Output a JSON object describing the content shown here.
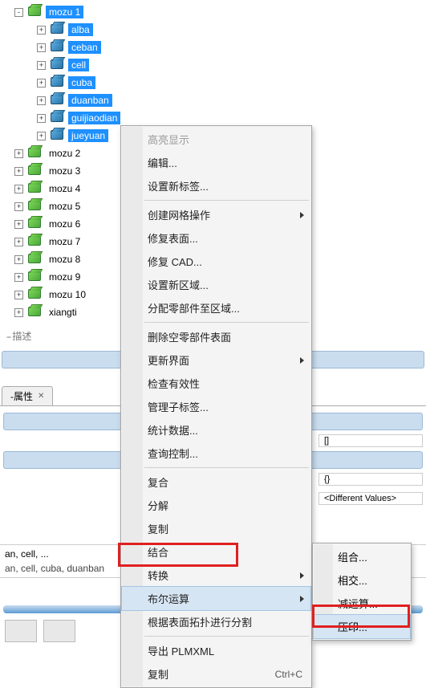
{
  "tree": {
    "root": {
      "label": "mozu 1",
      "expander": "-"
    },
    "selected_children": [
      {
        "label": "alba",
        "expander": "+"
      },
      {
        "label": "ceban",
        "expander": "+"
      },
      {
        "label": "cell",
        "expander": "+"
      },
      {
        "label": "cuba",
        "expander": "+"
      },
      {
        "label": "duanban",
        "expander": "+"
      },
      {
        "label": "guijiaodian",
        "expander": "+"
      },
      {
        "label": "jueyuan",
        "expander": "+"
      }
    ],
    "siblings": [
      {
        "label": "mozu 2",
        "expander": "+"
      },
      {
        "label": "mozu 3",
        "expander": "+"
      },
      {
        "label": "mozu 4",
        "expander": "+"
      },
      {
        "label": "mozu 5",
        "expander": "+"
      },
      {
        "label": "mozu 6",
        "expander": "+"
      },
      {
        "label": "mozu 7",
        "expander": "+"
      },
      {
        "label": "mozu 8",
        "expander": "+"
      },
      {
        "label": "mozu 9",
        "expander": "+"
      },
      {
        "label": "mozu 10",
        "expander": "+"
      },
      {
        "label": "xiangti",
        "expander": "+"
      }
    ]
  },
  "describe_tab": {
    "dash": "--",
    "label": " 描述"
  },
  "properties_tab": {
    "dash": "-",
    "label": " 属性",
    "close": "✕"
  },
  "prop_values": {
    "v1": "[]",
    "v2": "{}",
    "v3": "<Different Values>"
  },
  "selection": {
    "line1": "an, cell, ...",
    "line2": "an, cell, cuba, duanban"
  },
  "context_menu": {
    "items": [
      {
        "label": "高亮显示",
        "type": "disabled"
      },
      {
        "label": "编辑...",
        "type": "item"
      },
      {
        "label": "设置新标签...",
        "type": "item"
      },
      {
        "type": "sep"
      },
      {
        "label": "创建网格操作",
        "type": "submenu"
      },
      {
        "label": "修复表面...",
        "type": "item"
      },
      {
        "label": "修复 CAD...",
        "type": "item"
      },
      {
        "label": "设置新区域...",
        "type": "item"
      },
      {
        "label": "分配零部件至区域...",
        "type": "item"
      },
      {
        "type": "sep"
      },
      {
        "label": "删除空零部件表面",
        "type": "item"
      },
      {
        "label": "更新界面",
        "type": "submenu"
      },
      {
        "label": "检查有效性",
        "type": "item"
      },
      {
        "label": "管理子标签...",
        "type": "item"
      },
      {
        "label": "统计数据...",
        "type": "item"
      },
      {
        "label": "查询控制...",
        "type": "item"
      },
      {
        "type": "sep"
      },
      {
        "label": "复合",
        "type": "item"
      },
      {
        "label": "分解",
        "type": "item"
      },
      {
        "label": "复制",
        "type": "item"
      },
      {
        "label": "结合",
        "type": "item"
      },
      {
        "label": "转换",
        "type": "submenu"
      },
      {
        "label": "布尔运算",
        "type": "submenu",
        "hover": true
      },
      {
        "label": "根据表面拓扑进行分割",
        "type": "item"
      },
      {
        "type": "sep"
      },
      {
        "label": "导出 PLMXML",
        "type": "item"
      },
      {
        "label": "复制",
        "type": "item",
        "shortcut": "Ctrl+C"
      }
    ]
  },
  "submenu_boolean": {
    "items": [
      {
        "label": "组合..."
      },
      {
        "label": "相交..."
      },
      {
        "label": "减运算..."
      },
      {
        "label": "压印...",
        "hover": true
      }
    ]
  }
}
